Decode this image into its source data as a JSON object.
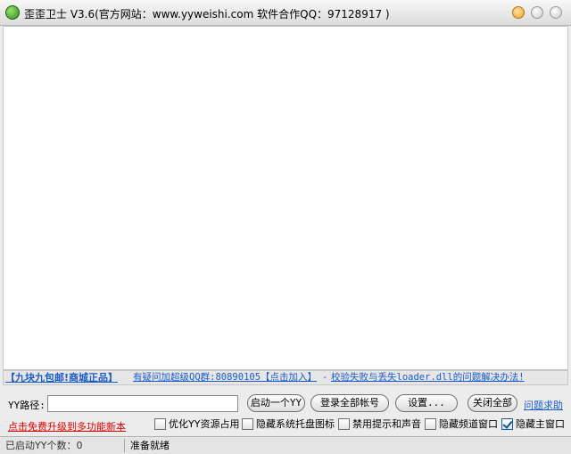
{
  "window": {
    "title": "歪歪卫士 V3.6(官方网站：www.yyweishi.com 软件合作QQ：97128917 )",
    "icon": "app-logo-icon"
  },
  "links": {
    "promo": "【九块九包邮!商城正品】",
    "group": "有疑问加超级QQ群:80890105【点击加入】",
    "sep": "-",
    "fix": "校验失败与丢失loader.dll的问题解决办法!"
  },
  "controls": {
    "yy_path_label": "YY路径:",
    "yy_path_value": "",
    "start_one_label": "启动一个YY",
    "login_all_label": "登录全部帐号",
    "settings_label": "设置...",
    "close_all_label": "关闭全部",
    "help_label": "问题求助",
    "upgrade_label": "点击免费升级到多功能新本"
  },
  "options": [
    {
      "label": "优化YY资源占用",
      "checked": false
    },
    {
      "label": "隐藏系统托盘图标",
      "checked": false
    },
    {
      "label": "禁用提示和声音",
      "checked": false
    },
    {
      "label": "隐藏频道窗口",
      "checked": false
    },
    {
      "label": "隐藏主窗口",
      "checked": true
    }
  ],
  "status": {
    "count_text": "已启动YY个数：0",
    "state_text": "准备就绪"
  },
  "colors": {
    "link": "#1a5cc8",
    "upgrade_link": "#e00000"
  }
}
